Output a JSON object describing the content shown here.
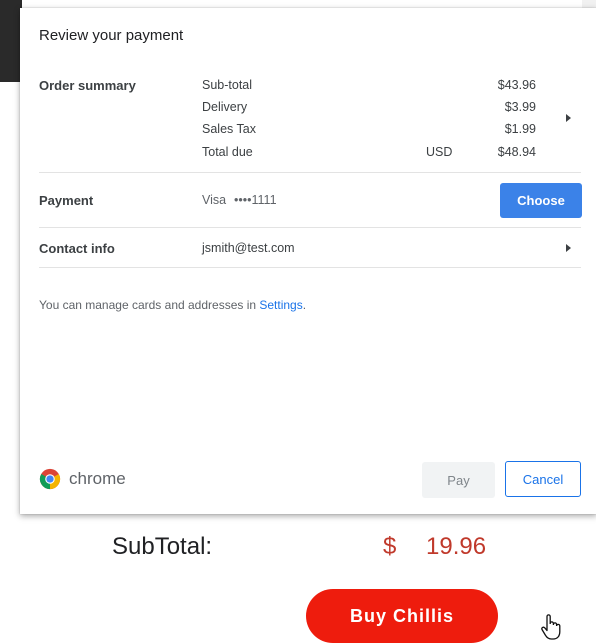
{
  "dialog": {
    "title": "Review your payment",
    "order_summary": {
      "label": "Order summary",
      "lines": [
        {
          "name": "Sub-total",
          "currency": "",
          "amount": "$43.96"
        },
        {
          "name": "Delivery",
          "currency": "",
          "amount": "$3.99"
        },
        {
          "name": "Sales Tax",
          "currency": "",
          "amount": "$1.99"
        },
        {
          "name": "Total due",
          "currency": "USD",
          "amount": "$48.94"
        }
      ]
    },
    "payment": {
      "label": "Payment",
      "card_brand": "Visa",
      "card_number": "••••1111",
      "choose_label": "Choose"
    },
    "contact": {
      "label": "Contact info",
      "email": "jsmith@test.com"
    },
    "manage_note": {
      "text": "You can manage cards and addresses in ",
      "link": "Settings",
      "suffix": "."
    },
    "footer": {
      "brand": "chrome",
      "pay_label": "Pay",
      "cancel_label": "Cancel"
    }
  },
  "page": {
    "subtotal_label": "SubTotal:",
    "subtotal_currency": "$",
    "subtotal_value": "19.96",
    "buy_label": "Buy Chillis"
  },
  "colors": {
    "choose_button": "#3b82e8",
    "link": "#1a73e8",
    "buy_button": "#ee1c0d",
    "price": "#c0392b"
  }
}
